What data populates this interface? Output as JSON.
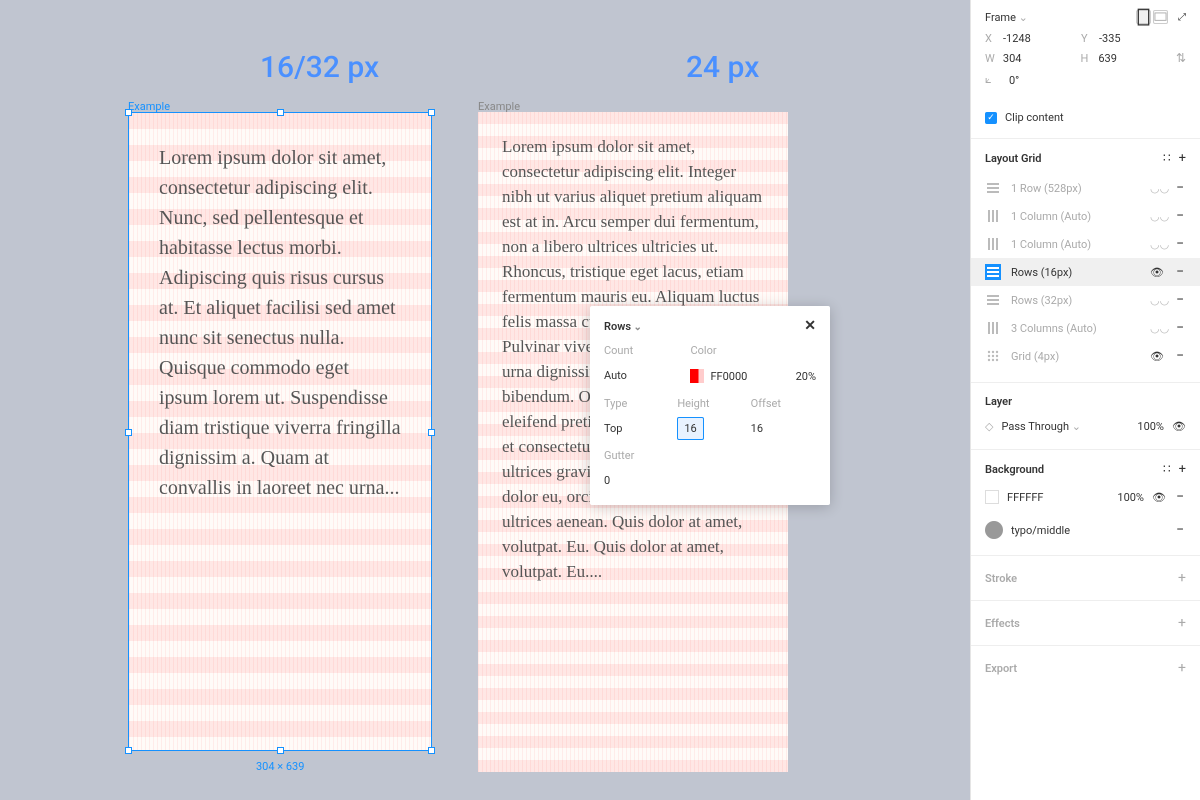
{
  "canvas": {
    "heading1": "16/32 px",
    "heading2": "24 px",
    "label1": "Example",
    "label2": "Example",
    "lorem1": "Lorem ipsum dolor sit amet, consectetur adipiscing elit. Nunc, sed pellentesque et habitasse lectus morbi. Adipiscing quis risus cursus at. Et aliquet facilisi sed amet nunc sit senectus nulla. Quisque commodo eget ipsum lorem ut. Suspendisse diam tristique viverra fringilla dignissim a. Quam at convallis in laoreet nec urna...",
    "lorem2": "Lorem ipsum dolor sit amet, consectetur adipiscing elit. Integer nibh ut varius aliquet pretium aliquam est at in. Arcu semper dui fermentum, non a libero ultrices ultricies ut. Rhoncus, tristique eget lacus, etiam fermentum mauris eu. Aliquam luctus felis massa cursus volutpat, tortor. Pulvinar viverra id lectus aliquet et, urna dignissim gravida arcu bibendum. Ornare faucibus eu, eleifend pretium, nec sed risus, purus et consectetur sed nam. Dolor magna ultrices gravida lacinia urna. Ipsum dolor eu, orci in fermentum euismod ultrices aenean. Quis dolor at amet, volutpat. Eu. Quis dolor at amet, volutpat. Eu....",
    "dimensions": "304 × 639"
  },
  "popup": {
    "title": "Rows",
    "count_label": "Count",
    "count_value": "Auto",
    "color_label": "Color",
    "color_hex": "FF0000",
    "color_opacity": "20%",
    "type_label": "Type",
    "type_value": "Top",
    "height_label": "Height",
    "height_value": "16",
    "offset_label": "Offset",
    "offset_value": "16",
    "gutter_label": "Gutter",
    "gutter_value": "0"
  },
  "panel": {
    "frame_type": "Frame",
    "x_label": "X",
    "x_value": "-1248",
    "y_label": "Y",
    "y_value": "-335",
    "w_label": "W",
    "w_value": "304",
    "h_label": "H",
    "h_value": "639",
    "rotation": "0°",
    "clip_label": "Clip content",
    "layout_grid_title": "Layout Grid",
    "grid_items": [
      {
        "label": "1 Row (528px)",
        "icon": "rows",
        "visible": false
      },
      {
        "label": "1 Column (Auto)",
        "icon": "cols",
        "visible": false
      },
      {
        "label": "1 Column (Auto)",
        "icon": "cols",
        "visible": false
      },
      {
        "label": "Rows (16px)",
        "icon": "rows",
        "visible": true,
        "active": true
      },
      {
        "label": "Rows (32px)",
        "icon": "rows",
        "visible": false
      },
      {
        "label": "3 Columns (Auto)",
        "icon": "cols",
        "visible": false
      },
      {
        "label": "Grid (4px)",
        "icon": "grid",
        "visible": true
      }
    ],
    "layer_title": "Layer",
    "layer_mode": "Pass Through",
    "layer_opacity": "100%",
    "background_title": "Background",
    "bg_hex": "FFFFFF",
    "bg_opacity": "100%",
    "typo_label": "typo/middle",
    "stroke_title": "Stroke",
    "effects_title": "Effects",
    "export_title": "Export"
  }
}
